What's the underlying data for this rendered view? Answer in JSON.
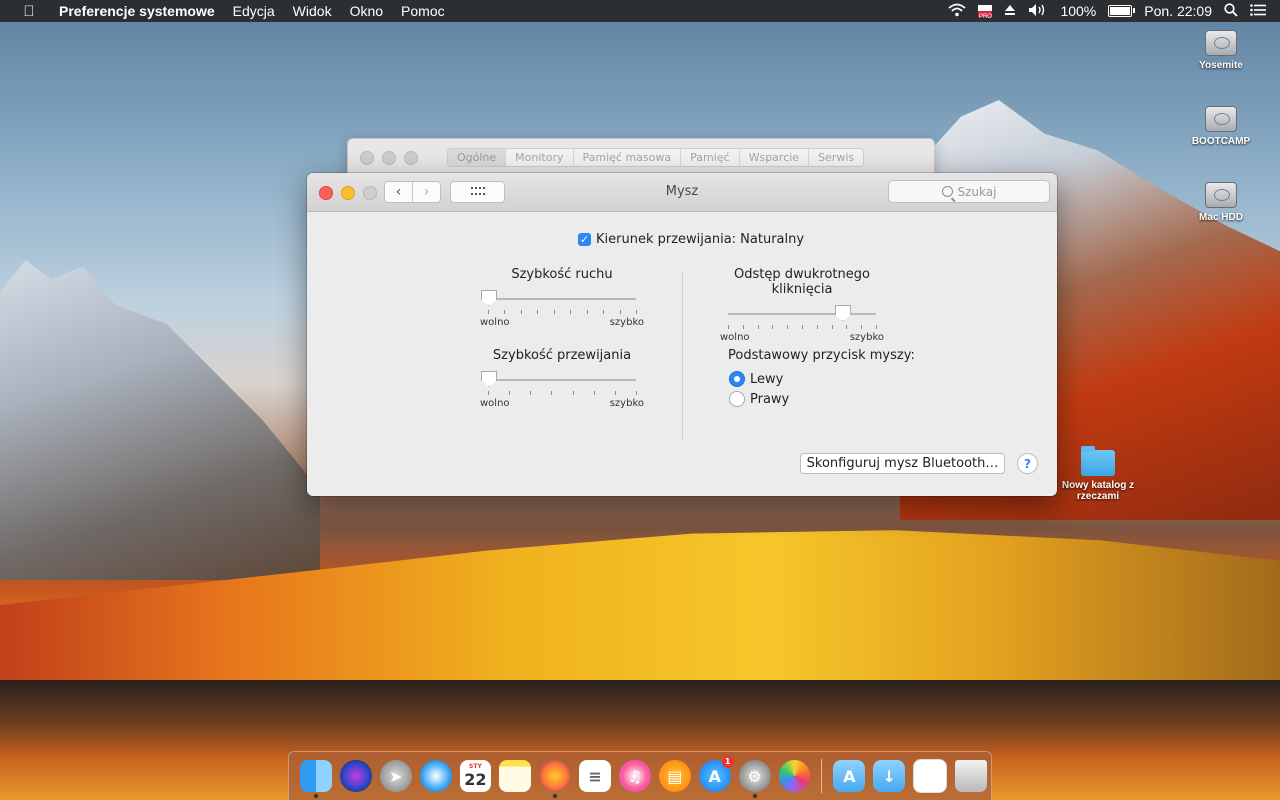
{
  "menubar": {
    "apple_icon": "apple-icon",
    "app_name": "Preferencje systemowe",
    "items": [
      "Edycja",
      "Widok",
      "Okno",
      "Pomoc"
    ],
    "status": {
      "battery_percent": "100%",
      "clock": "Pon. 22:09",
      "flag_badge": "PRO"
    }
  },
  "desktop": {
    "drives": [
      "Yosemite",
      "BOOTCAMP",
      "Mac HDD"
    ],
    "folder": "Nowy katalog z rzeczami"
  },
  "background_window": {
    "tabs": [
      "Ogólne",
      "Monitory",
      "Pamięć masowa",
      "Pamięć",
      "Wsparcie",
      "Serwis"
    ],
    "active_tab": "Ogólne"
  },
  "window": {
    "title": "Mysz",
    "search_placeholder": "Szukaj",
    "natural_scroll": {
      "label": "Kierunek przewijania: Naturalny",
      "checked": true
    },
    "tracking_speed": {
      "title": "Szybkość ruchu",
      "min_label": "wolno",
      "max_label": "szybko",
      "value": 0.0
    },
    "scroll_speed": {
      "title": "Szybkość przewijania",
      "min_label": "wolno",
      "max_label": "szybko",
      "value": 0.0
    },
    "double_click": {
      "title": "Odstęp dwukrotnego kliknięcia",
      "min_label": "wolno",
      "max_label": "szybko",
      "value": 0.77
    },
    "primary_button": {
      "title": "Podstawowy przycisk myszy:",
      "options": [
        "Lewy",
        "Prawy"
      ],
      "selected": "Lewy"
    },
    "bluetooth_button": "Skonfiguruj mysz Bluetooth…",
    "help_button": "?"
  },
  "dock": {
    "calendar_month": "STY",
    "calendar_day": "22",
    "appstore_badge": "1"
  }
}
